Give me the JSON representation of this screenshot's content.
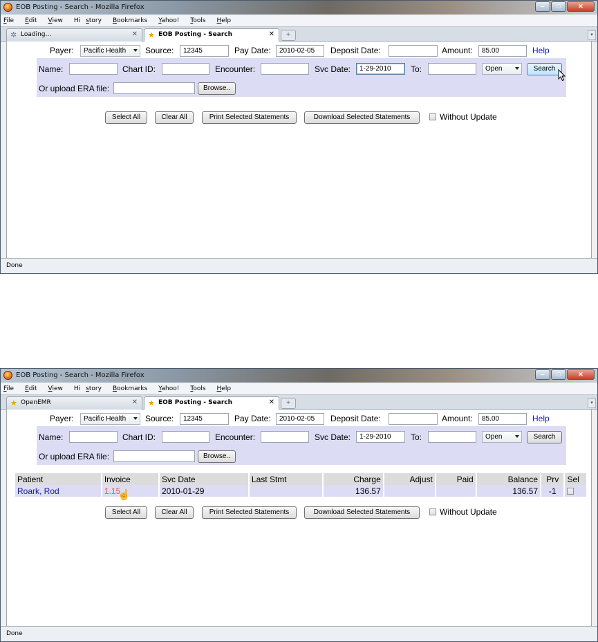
{
  "shots": {
    "before": {
      "window_title": "EOB Posting - Search - Mozilla Firefox",
      "tab1_label": "Loading...",
      "tab2_label": "EOB Posting - Search",
      "status": "Done"
    },
    "after": {
      "window_title": "EOB Posting - Search - Mozilla Firefox",
      "tab1_label": "OpenEMR",
      "tab2_label": "EOB Posting - Search",
      "status": "Done"
    }
  },
  "menu": {
    "file": "ile",
    "file_key": "F",
    "edit": "dit",
    "edit_key": "E",
    "view": "iew",
    "view_key": "V",
    "history_pre": "Hi",
    "history_key": "s",
    "history_post": "tory",
    "bookmarks": "ookmarks",
    "bookmarks_key": "B",
    "yahoo": "ahoo!",
    "yahoo_key": "Y",
    "tools": "ools",
    "tools_key": "T",
    "help": "elp",
    "help_key": "H"
  },
  "form": {
    "payer_label": "Payer:",
    "payer_value": "Pacific Health",
    "source_label": "Source:",
    "source_value": "12345",
    "pay_date_label": "Pay Date:",
    "pay_date_value": "2010-02-05",
    "deposit_date_label": "Deposit Date:",
    "deposit_date_value": "",
    "amount_label": "Amount:",
    "amount_value": "85.00",
    "help_link": "Help",
    "name_label": "Name:",
    "chart_id_label": "Chart ID:",
    "encounter_label": "Encounter:",
    "svc_date_label": "Svc Date:",
    "svc_date_value": "1-29-2010",
    "to_label": "To:",
    "status_select": "Open",
    "search_button": "Search",
    "upload_label": "Or upload ERA file:",
    "browse_button": "Browse.."
  },
  "actions": {
    "select_all": "Select All",
    "clear_all": "Clear All",
    "print_selected": "Print Selected Statements",
    "download_selected": "Download Selected Statements",
    "without_update": "Without Update"
  },
  "results": {
    "headers": [
      "Patient",
      "Invoice",
      "Svc Date",
      "Last Stmt",
      "Charge",
      "Adjust",
      "Paid",
      "Balance",
      "Prv",
      "Sel"
    ],
    "rows": [
      {
        "patient": "Roark, Rod",
        "invoice": "1.15",
        "svc_date": "2010-01-29",
        "last_stmt": "",
        "charge": "136.57",
        "adjust": "",
        "paid": "",
        "balance": "136.57",
        "prv": "-1"
      }
    ]
  },
  "colors": {
    "band": "#dcdcf5",
    "link": "#1a1ab3",
    "invoice_link": "#e35a5a"
  }
}
